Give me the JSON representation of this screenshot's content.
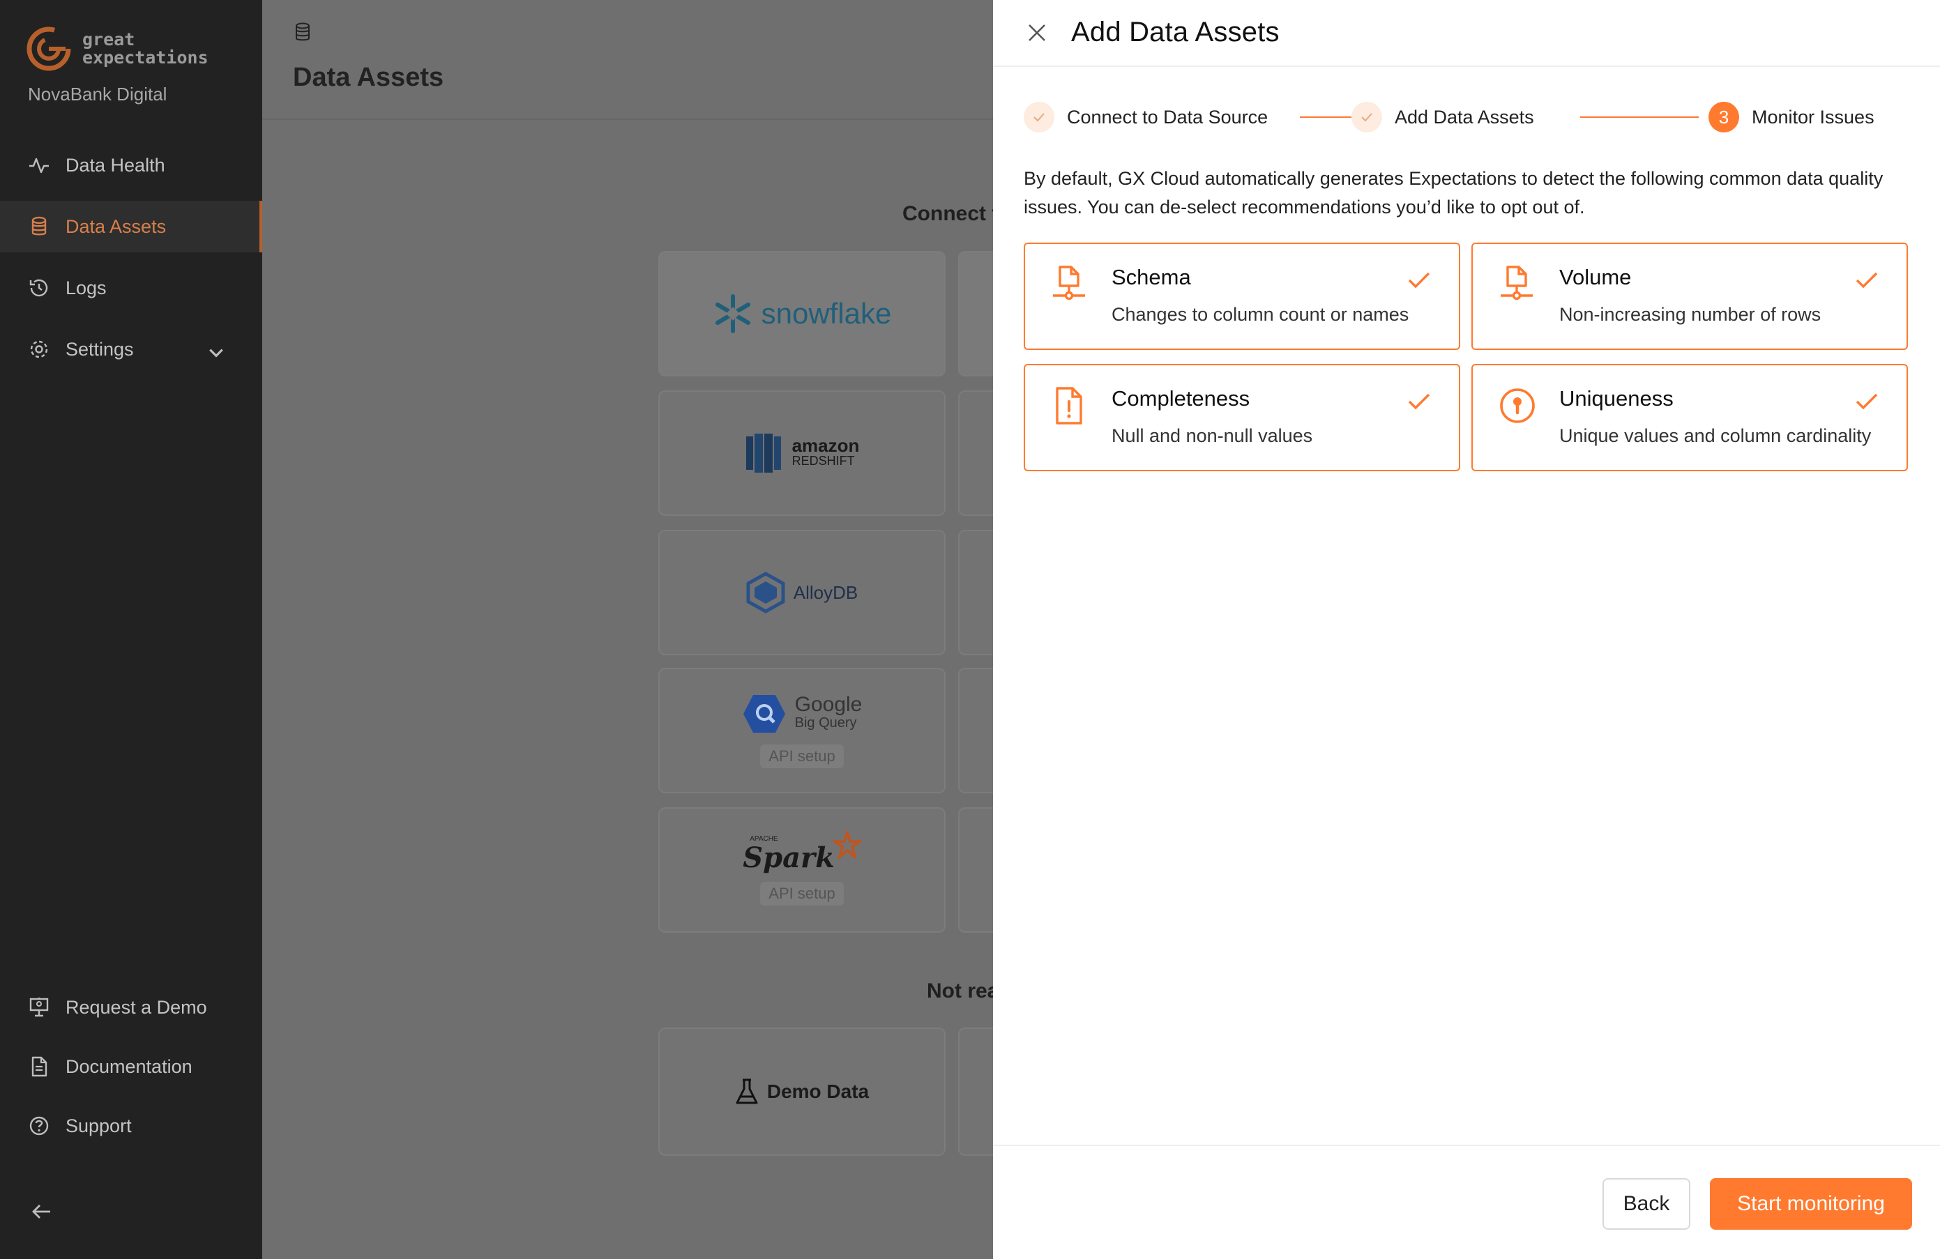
{
  "sidebar": {
    "logo_line1": "great",
    "logo_line2": "expectations",
    "org_name": "NovaBank Digital",
    "nav": [
      {
        "label": "Data Health",
        "icon": "activity-icon"
      },
      {
        "label": "Data Assets",
        "icon": "database-icon",
        "active": true
      },
      {
        "label": "Logs",
        "icon": "history-icon"
      },
      {
        "label": "Settings",
        "icon": "gear-icon"
      }
    ],
    "bottom_nav": [
      {
        "label": "Request a Demo",
        "icon": "presentation-icon"
      },
      {
        "label": "Documentation",
        "icon": "document-icon"
      },
      {
        "label": "Support",
        "icon": "help-circle-icon"
      }
    ]
  },
  "main": {
    "title": "Data Assets",
    "connect_heading": "Connect t",
    "not_ready": "Not rea",
    "tiles": [
      {
        "name": "snowflake",
        "label": "snowflake"
      },
      {
        "name": "redshift",
        "label_top": "amazon",
        "label_bottom": "REDSHIFT"
      },
      {
        "name": "alloydb",
        "label": "AlloyDB"
      },
      {
        "name": "bigquery",
        "label_top": "Google",
        "label_bottom": "Big Query",
        "pill": "API setup"
      },
      {
        "name": "spark",
        "label_top": "APACHE",
        "label": "Spark",
        "pill": "API setup"
      },
      {
        "name": "demo-data",
        "label": "Demo Data"
      }
    ]
  },
  "drawer": {
    "title": "Add Data Assets",
    "steps": [
      {
        "label": "Connect to Data Source",
        "state": "done"
      },
      {
        "label": "Add Data Assets",
        "state": "done"
      },
      {
        "label": "Monitor Issues",
        "state": "current",
        "number": "3"
      }
    ],
    "intro": "By default, GX Cloud automatically generates Expectations to detect the following common data quality issues. You can de-select recommendations you’d like to opt out of.",
    "cards": [
      {
        "title": "Schema",
        "desc": "Changes to column count or names",
        "checked": true,
        "icon": "file-tree-icon"
      },
      {
        "title": "Volume",
        "desc": "Non-increasing number of rows",
        "checked": true,
        "icon": "file-tree-icon"
      },
      {
        "title": "Completeness",
        "desc": "Null and non-null values",
        "checked": true,
        "icon": "file-alert-icon"
      },
      {
        "title": "Uniqueness",
        "desc": "Unique values and column cardinality",
        "checked": true,
        "icon": "key-circle-icon"
      }
    ],
    "back_label": "Back",
    "start_label": "Start monitoring"
  },
  "colors": {
    "accent": "#ff7a2f",
    "sidebar_bg": "#222222",
    "overlay_bg": "#6f6f6f",
    "active_nav": "#d77f4c"
  }
}
